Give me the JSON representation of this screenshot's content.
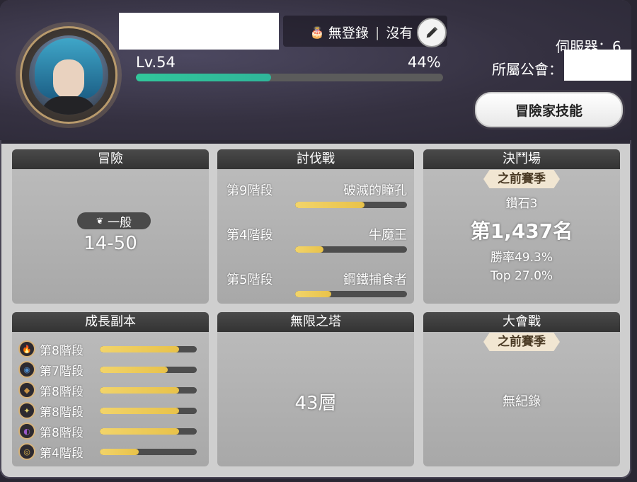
{
  "profile": {
    "level": "Lv.54",
    "exp_percent": "44%",
    "exp_fill": 0.44,
    "birthday_label": "無登錄",
    "gender_label": "沒有",
    "server_label": "伺服器：6",
    "guild_label": "所屬公會："
  },
  "buttons": {
    "skills": "冒險家技能"
  },
  "adventure": {
    "title": "冒險",
    "difficulty": "一般",
    "stage": "14-50"
  },
  "subjugation": {
    "title": "討伐戰",
    "rows": [
      {
        "stage": "第9階段",
        "boss": "破滅的瞳孔",
        "progress": 0.62
      },
      {
        "stage": "第4階段",
        "boss": "牛魔王",
        "progress": 0.25
      },
      {
        "stage": "第5階段",
        "boss": "鋼鐵捕食者",
        "progress": 0.32
      }
    ]
  },
  "arena": {
    "title": "決鬥場",
    "season": "之前賽季",
    "tier": "鑽石3",
    "rank": "第1,437名",
    "win_rate": "勝率49.3%",
    "top": "Top 27.0%"
  },
  "growth": {
    "title": "成長副本",
    "rows": [
      {
        "icon": "fire-icon",
        "stage": "第8階段",
        "progress": 0.82,
        "color": "#c9554b"
      },
      {
        "icon": "water-icon",
        "stage": "第7階段",
        "progress": 0.7,
        "color": "#4f8fd0"
      },
      {
        "icon": "earth-icon",
        "stage": "第8階段",
        "progress": 0.82,
        "color": "#c79244"
      },
      {
        "icon": "light-icon",
        "stage": "第8階段",
        "progress": 0.82,
        "color": "#e2d16a"
      },
      {
        "icon": "dark-icon",
        "stage": "第8階段",
        "progress": 0.82,
        "color": "#9b5ac9"
      },
      {
        "icon": "gold-icon",
        "stage": "第4階段",
        "progress": 0.4,
        "color": "#e1b74a"
      }
    ]
  },
  "tower": {
    "title": "無限之塔",
    "floor": "43層"
  },
  "guild_war": {
    "title": "大會戰",
    "season": "之前賽季",
    "record": "無紀錄"
  }
}
